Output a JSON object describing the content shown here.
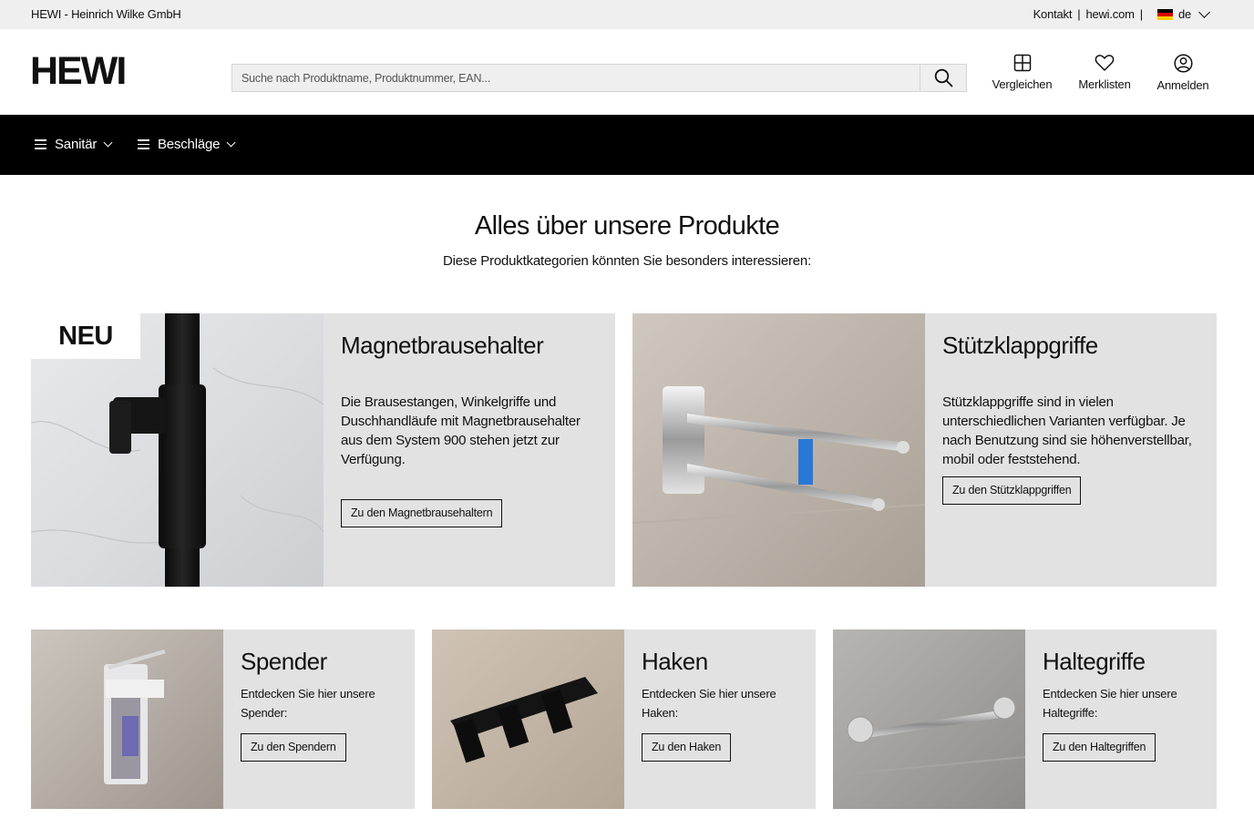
{
  "topbar": {
    "company": "HEWI - Heinrich Wilke GmbH",
    "contact": "Kontakt",
    "site": "hewi.com",
    "separator": "|",
    "language": "de"
  },
  "header": {
    "logo": "HEWI",
    "search_placeholder": "Suche nach Produktname, Produktnummer, EAN...",
    "compare": "Vergleichen",
    "wishlists": "Merklisten",
    "login": "Anmelden"
  },
  "nav": {
    "items": [
      {
        "label": "Sanitär"
      },
      {
        "label": "Beschläge"
      }
    ]
  },
  "main": {
    "title": "Alles über unsere Produkte",
    "subtitle": "Diese Produktkategorien könnten Sie besonders interessieren:"
  },
  "cards": {
    "magnet": {
      "badge": "NEU",
      "title": "Magnetbrausehalter",
      "text": "Die Brausestangen, Winkelgriffe und Duschhandläufe mit Magnetbrausehalter aus dem System 900 stehen jetzt zur Verfügung.",
      "cta": "Zu den Magnetbrausehaltern"
    },
    "stuetz": {
      "title": "Stützklappgriffe",
      "text": "Stützklappgriffe sind in vielen unterschiedlichen Varianten verfügbar. Je nach Benutzung sind sie höhenverstellbar, mobil oder feststehend.",
      "cta": "Zu den Stützklappgriffen"
    },
    "spender": {
      "title": "Spender",
      "text": "Entdecken Sie hier unsere Spender:",
      "cta": "Zu den Spendern"
    },
    "haken": {
      "title": "Haken",
      "text": "Entdecken Sie hier unsere Haken:",
      "cta": "Zu den Haken"
    },
    "halte": {
      "title": "Haltegriffe",
      "text": "Entdecken Sie hier unsere Haltegriffe:",
      "cta": "Zu den Haltegriffen"
    }
  }
}
